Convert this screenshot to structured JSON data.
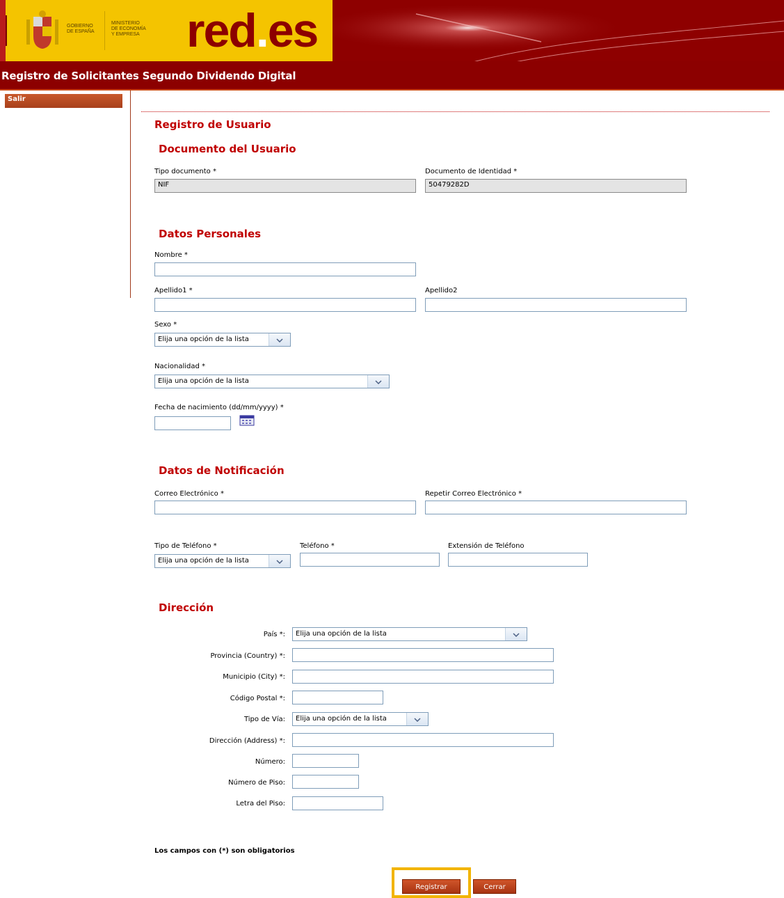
{
  "header": {
    "gov_line1": "GOBIERNO",
    "gov_line2": "DE ESPAÑA",
    "ministry_line1": "MINISTERIO",
    "ministry_line2": "DE ECONOMÍA",
    "ministry_line3": "Y EMPRESA",
    "logo_main": "red",
    "logo_dot": ".",
    "logo_tail": "es",
    "app_title": "Registro de Solicitantes Segundo Dividendo Digital"
  },
  "sidebar": {
    "salir_label": "Salir"
  },
  "page": {
    "title": "Registro de Usuario",
    "doc_section": "Documento del Usuario",
    "tipo_doc_label": "Tipo documento *",
    "tipo_doc_value": "NIF",
    "doc_id_label": "Documento de Identidad *",
    "doc_id_value": "50479282D",
    "personal_section": "Datos Personales",
    "nombre_label": "Nombre *",
    "apellido1_label": "Apellido1 *",
    "apellido2_label": "Apellido2",
    "sexo_label": "Sexo *",
    "sexo_value": "Elija una opción de la lista",
    "nacionalidad_label": "Nacionalidad *",
    "nacionalidad_value": "Elija una opción de la lista",
    "fecha_label": "Fecha de nacimiento (dd/mm/yyyy) *",
    "notif_section": "Datos de Notificación",
    "correo_label": "Correo Electrónico *",
    "correo_rep_label": "Repetir Correo Electrónico *",
    "tipo_tel_label": "Tipo de Teléfono *",
    "tipo_tel_value": "Elija una opción de la lista",
    "telefono_label": "Teléfono *",
    "extension_label": "Extensión de Teléfono",
    "dir_section": "Dirección",
    "pais_label": "País *:",
    "pais_value": "Elija una opción de la lista",
    "provincia_label": "Provincia (Country) *:",
    "municipio_label": "Municipio (City) *:",
    "cp_label": "Código Postal *:",
    "tipo_via_label": "Tipo de Vía:",
    "tipo_via_value": "Elija una opción de la lista",
    "direccion_label": "Dirección (Address) *:",
    "numero_label": "Número:",
    "piso_label": "Número de Piso:",
    "letra_label": "Letra del Piso:",
    "note": "Los campos con (*) son obligatorios"
  },
  "buttons": {
    "registrar": "Registrar",
    "cerrar": "Cerrar"
  },
  "icons": {
    "calendar": "calendar-icon",
    "dropdown": "chevron-down-icon",
    "shield": "coat-of-arms-icon"
  },
  "colors": {
    "brand_red": "#8c0000",
    "heading_red": "#c00000",
    "button_orange": "#c04a20",
    "focus_highlight": "#f2b400",
    "gov_yellow": "#f4c400"
  }
}
